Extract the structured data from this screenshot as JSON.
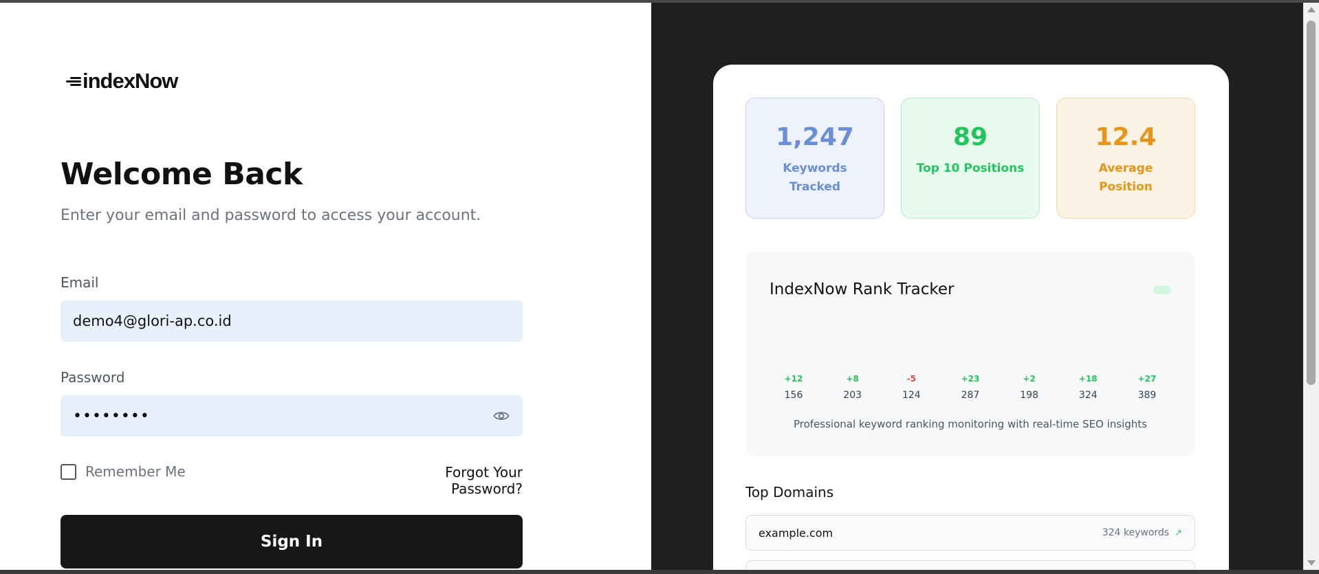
{
  "brand": {
    "logo_text": "indexNow"
  },
  "login": {
    "title": "Welcome Back",
    "subtitle": "Enter your email and password to access your account.",
    "email_label": "Email",
    "email_value": "demo4@glori-ap.co.id",
    "password_label": "Password",
    "password_masked": "••••••••",
    "remember_label": "Remember Me",
    "forgot_label": "Forgot Your Password?",
    "signin_label": "Sign In"
  },
  "stats": [
    {
      "value": "1,247",
      "label": "Keywords Tracked",
      "color": "#6a8fd6"
    },
    {
      "value": "89",
      "label": "Top 10 Positions",
      "color": "#22c55e"
    },
    {
      "value": "12.4",
      "label": "Average Position",
      "color": "#e6951b"
    }
  ],
  "tracker": {
    "title": "IndexNow Rank Tracker",
    "bars": [
      {
        "delta": "+12",
        "value": "156"
      },
      {
        "delta": "+8",
        "value": "203"
      },
      {
        "delta": "-5",
        "value": "124"
      },
      {
        "delta": "+23",
        "value": "287"
      },
      {
        "delta": "+2",
        "value": "198"
      },
      {
        "delta": "+18",
        "value": "324"
      },
      {
        "delta": "+27",
        "value": "389"
      }
    ],
    "note": "Professional keyword ranking monitoring with real-time SEO insights"
  },
  "domains": {
    "title": "Top Domains",
    "items": [
      {
        "name": "example.com",
        "keywords": "324 keywords",
        "trend_icon": "↗"
      }
    ]
  },
  "icons": {
    "eye": "eye-icon",
    "trend": "trend-up-icon"
  }
}
